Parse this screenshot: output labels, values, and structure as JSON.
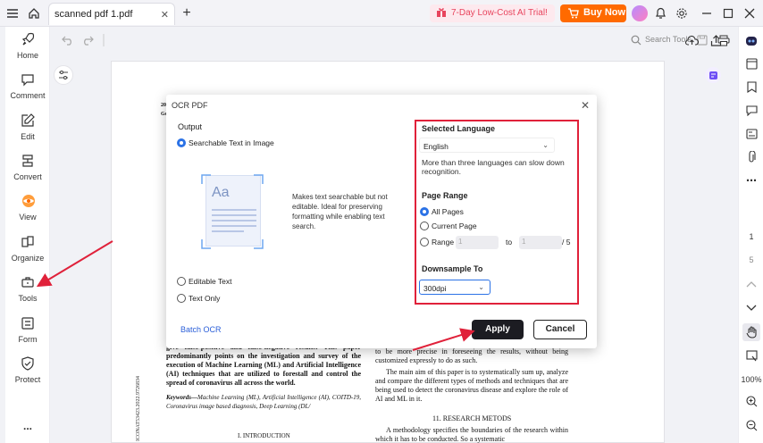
{
  "titlebar": {
    "tab_label": "scanned pdf 1.pdf",
    "tab_close": "✕",
    "new_tab": "+",
    "trial_label": "7-Day Low-Cost AI Trial!",
    "buy_label": "Buy Now"
  },
  "toolbar": {
    "search_label": "Search Tools"
  },
  "sidebar": {
    "items": [
      {
        "label": "Home",
        "icon": "rocket-icon"
      },
      {
        "label": "Comment",
        "icon": "comment-icon"
      },
      {
        "label": "Edit",
        "icon": "edit-icon"
      },
      {
        "label": "Convert",
        "icon": "convert-icon"
      },
      {
        "label": "View",
        "icon": "view-icon"
      },
      {
        "label": "Organize",
        "icon": "organize-icon"
      },
      {
        "label": "Tools",
        "icon": "tools-icon"
      },
      {
        "label": "Form",
        "icon": "form-icon"
      },
      {
        "label": "Protect",
        "icon": "shield-icon"
      }
    ],
    "more": "..."
  },
  "rightrail": {
    "page_current": "1",
    "page_total": "5",
    "zoom": "100%"
  },
  "dialog": {
    "title": "OCR PDF",
    "output_label": "Output",
    "options": {
      "searchable": "Searchable Text in Image",
      "editable": "Editable Text",
      "text_only": "Text Only"
    },
    "thumb_glyph": "Aa",
    "description": "Makes text searchable but not editable. Ideal for preserving formatting while enabling text search.",
    "batch_label": "Batch OCR",
    "apply_label": "Apply",
    "cancel_label": "Cancel",
    "language": {
      "label": "Selected Language",
      "value": "English",
      "hint": "More than three languages can slow down recognition."
    },
    "page_range": {
      "label": "Page Range",
      "all": "All Pages",
      "current": "Current Page",
      "range": "Range",
      "from_placeholder": "1",
      "to_label": "to",
      "to_placeholder": "1",
      "total": "/ 5"
    },
    "downsample": {
      "label": "Downsample To",
      "value": "300dpi"
    }
  },
  "paper": {
    "header_left_1": "202",
    "header_left_2": "Go",
    "col_left": "give false-positive and false-negative results. This paper predominantly points on the investigation and survey of the execution of Machine Learning (ML) and Artificial Intelligence (AI) techniques that are utilized to forestall and control the spread of coronavirus all across the world.",
    "keywords_label": "Keywords—",
    "keywords": "Machine Learning (ML), Artificial Intelligence (AI), COITD-19, Coronavirus image based diagnosis, Deep Learning (DL/",
    "section_1": "I.        INTRODUCTION",
    "col_right_1": "to be more precise in foreseeing the results, without being customized expressly to do as such.",
    "col_right_2": "The main aim of this paper is to systematically sum up, analyze and compare the different types of methods and techniques that are being used to detect the coronavirus disease and explore the role of AI and ML in it.",
    "section_2": "11.      RESEARCH METODS",
    "col_right_3": "A methodology specifies the boundaries of the research within which it has to be conducted. So a systematic",
    "vertical": "ICONAT53423.2022.9726834"
  },
  "colors": {
    "accent": "#ff6a00",
    "highlight": "#e0213a",
    "link": "#2b5fd9",
    "radio": "#2b72e6"
  }
}
